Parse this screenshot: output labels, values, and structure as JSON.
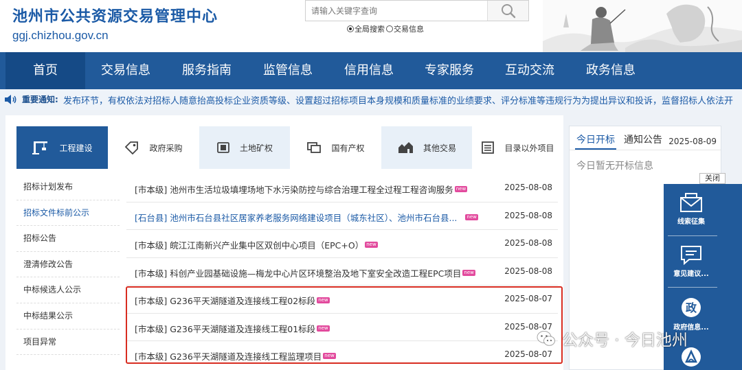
{
  "header": {
    "title": "池州市公共资源交易管理中心",
    "domain": "ggj.chizhou.gov.cn",
    "search": {
      "placeholder": "请输入关键字查询",
      "scope_all": "全局搜索",
      "scope_trade": "交易信息"
    }
  },
  "nav": {
    "items": [
      "首页",
      "交易信息",
      "服务指南",
      "监管信息",
      "信用信息",
      "专家服务",
      "互动交流",
      "政务信息"
    ]
  },
  "notice": {
    "label": "重要通知:",
    "text": "发布环节，有权依法对招标人随意抬高投标企业资质等级、设置超过招标项目本身规模和质量标准的业绩要求、评分标准等违规行为为提出异议和投诉，监督招标人依法开"
  },
  "tabs": [
    "工程建设",
    "政府采购",
    "土地矿权",
    "国有产权",
    "其他交易",
    "目录以外项目"
  ],
  "sidebar": {
    "items": [
      "招标计划发布",
      "招标文件标前公示",
      "招标公告",
      "澄清修改公告",
      "中标候选人公示",
      "中标结果公示",
      "项目异常"
    ]
  },
  "list": {
    "badge": "new",
    "rows": [
      {
        "title": "[市本级] 池州市生活垃圾填埋场地下水污染防控与综合治理工程全过程工程咨询服务",
        "date": "2025-08-08"
      },
      {
        "title": "[石台县] 池州市石台县社区居家养老服务网络建设项目（城东社区）、池州市石台县...",
        "date": "2025-08-08"
      },
      {
        "title": "[市本级] 皖江江南新兴产业集中区双创中心项目（EPC+O）",
        "date": "2025-08-08"
      },
      {
        "title": "[市本级] 科创产业园基础设施—梅龙中心片区环境整治及地下室安全改造工程EPC项目",
        "date": "2025-08-08"
      },
      {
        "title": "[市本级] G236平天湖隧道及连接线工程02标段",
        "date": "2025-08-07"
      },
      {
        "title": "[市本级] G236平天湖隧道及连接线工程01标段",
        "date": "2025-08-07"
      },
      {
        "title": "[市本级] G236平天湖隧道及连接线工程监理项目",
        "date": "2025-08-07"
      }
    ]
  },
  "right_panel": {
    "tab_today": "今日开标",
    "tab_notice": "通知公告",
    "date": "2025-08-09",
    "empty_text": "今日暂无开标信息"
  },
  "float_bar": {
    "close": "关闭",
    "items": [
      "线索征集",
      "意见建议...",
      "政府信息...",
      ""
    ]
  },
  "watermark": {
    "text": "公众号 · 今日池州"
  },
  "colors": {
    "brand_blue": "#215a9a",
    "highlight_red": "#d82c20",
    "badge_pink": "#e24a9d"
  }
}
